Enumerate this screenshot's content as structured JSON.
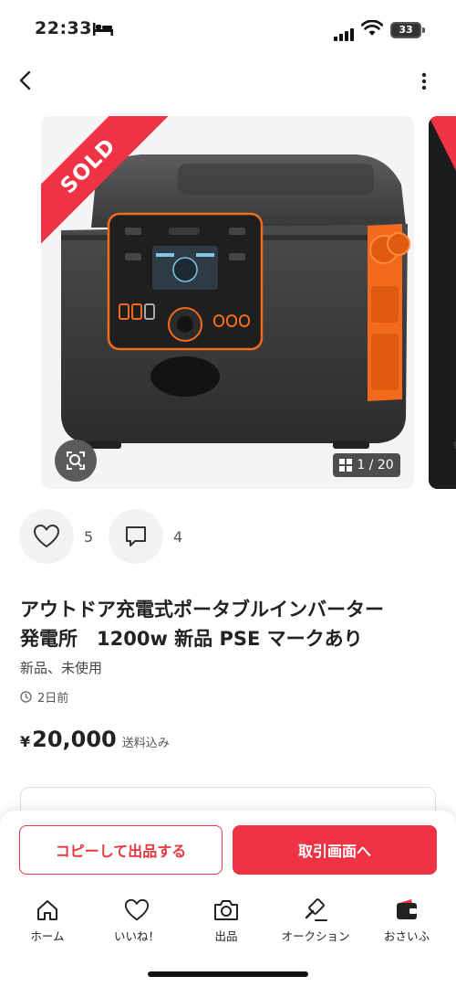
{
  "status_bar": {
    "time": "22:33",
    "battery": "33"
  },
  "nav": {
    "back_icon": "chevron-left-icon",
    "more_icon": "vertical-ellipsis-icon"
  },
  "gallery": {
    "sold_label": "SOLD",
    "counter": "1 / 20",
    "lens_icon": "image-search-icon"
  },
  "reactions": {
    "likes": "5",
    "comments": "4"
  },
  "item": {
    "title_line1": "アウトドア充電式ポータブルインバーター",
    "title_line2": "発電所　1200w 新品 PSE マークあり",
    "condition": "新品、未使用",
    "posted": "2日前",
    "price_currency": "¥",
    "price": "20,000",
    "shipping": "送料込み"
  },
  "actions": {
    "copy_listing": "コピーして出品する",
    "go_trade": "取引画面へ"
  },
  "tabbar": {
    "items": [
      {
        "label": "ホーム",
        "icon": "home-icon"
      },
      {
        "label": "いいね！",
        "icon": "heart-icon"
      },
      {
        "label": "出品",
        "icon": "camera-icon"
      },
      {
        "label": "オークション",
        "icon": "gavel-icon"
      },
      {
        "label": "おさいふ",
        "icon": "wallet-icon"
      }
    ]
  },
  "colors": {
    "accent_red": "#ee3344",
    "product_orange": "#f26b1d"
  }
}
